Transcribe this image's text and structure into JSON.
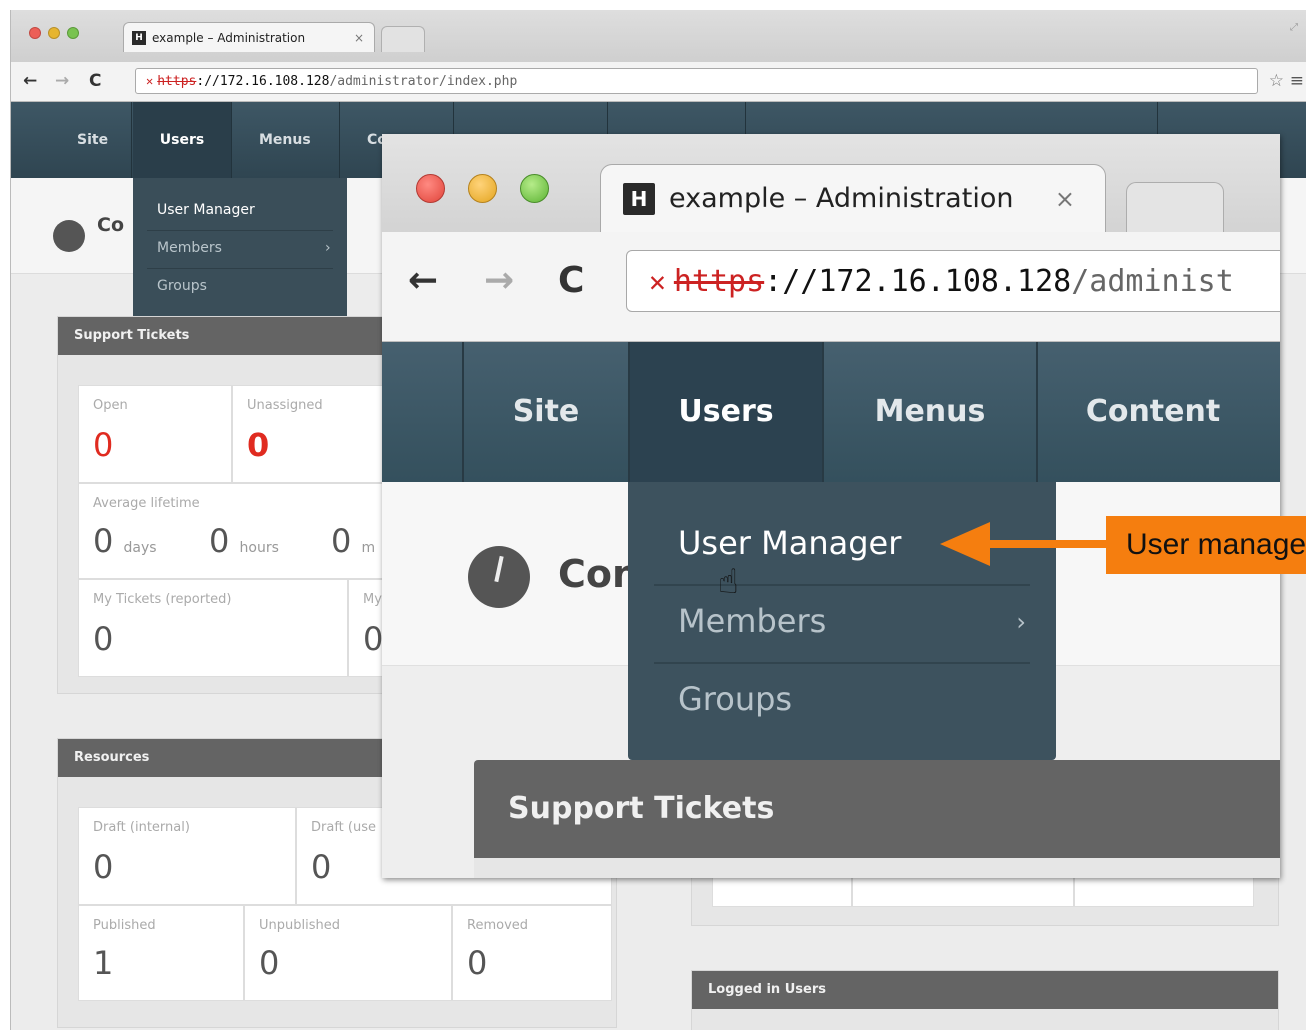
{
  "browser": {
    "tab_title": "example – Administration",
    "favicon": "H",
    "tab_close": "×",
    "url_https": "https",
    "url_rest_host": "://172.16.108.128",
    "url_path": "/administrator/index.php",
    "zoom_url_path": "/administ"
  },
  "nav": {
    "site": "Site",
    "users": "Users",
    "menus": "Menus",
    "content": "Content",
    "content_short": "Co"
  },
  "users_menu": {
    "items": [
      "User Manager",
      "Members",
      "Groups"
    ],
    "chevron": "›"
  },
  "header": {
    "title_fragment": "Co",
    "zoom_title_fragment": "Con"
  },
  "support_tickets": {
    "title": "Support Tickets",
    "open_label": "Open",
    "open_value": "0",
    "unassigned_label": "Unassigned",
    "unassigned_value": "0",
    "avg_label": "Average lifetime",
    "days_value": "0",
    "days_unit": "days",
    "hours_value": "0",
    "hours_unit": "hours",
    "mins_value": "0",
    "mins_unit": "m",
    "my_reported_label": "My Tickets (reported)",
    "my_reported_value": "0",
    "my_other_label": "My",
    "my_other_value": "0"
  },
  "resources": {
    "title": "Resources",
    "draft_internal_label": "Draft (internal)",
    "draft_internal_value": "0",
    "draft_user_label": "Draft (use",
    "draft_user_value": "0",
    "published_label": "Published",
    "published_value": "1",
    "unpublished_label": "Unpublished",
    "unpublished_value": "0",
    "removed_label": "Removed",
    "removed_value": "0"
  },
  "logged_in": {
    "title": "Logged in Users"
  },
  "callout": {
    "text": "User manager",
    "color": "#f57e0f"
  },
  "icons": {
    "back": "←",
    "forward": "→",
    "reload": "C",
    "star": "☆",
    "menu": "≡",
    "cursor": "hand-pointer"
  }
}
